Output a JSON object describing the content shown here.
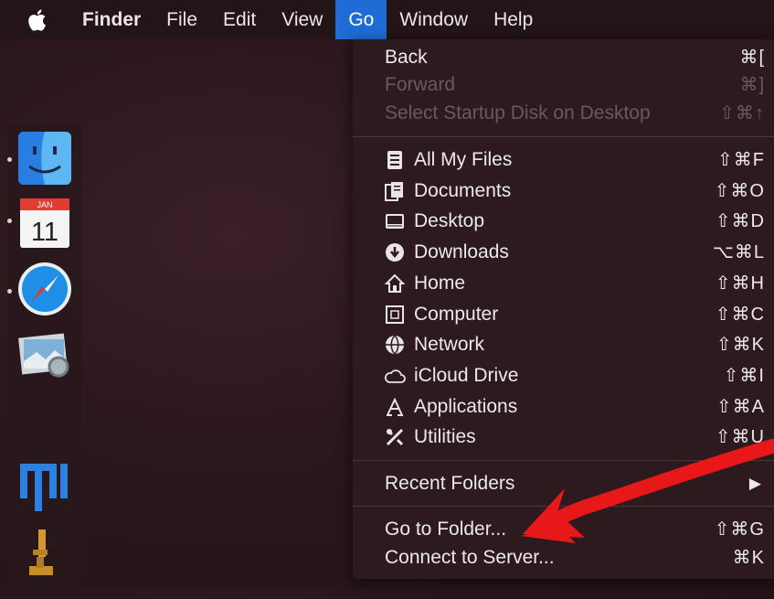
{
  "menubar": {
    "apple_icon": "apple-icon",
    "items": [
      "Finder",
      "File",
      "Edit",
      "View",
      "Go",
      "Window",
      "Help"
    ],
    "active": "Go"
  },
  "dock": {
    "items": [
      "finder-icon",
      "calendar-icon",
      "safari-icon",
      "preview-icon",
      "mi-icon",
      "microscope-icon"
    ],
    "calendar": {
      "month": "JAN",
      "day": "11"
    }
  },
  "go_menu": {
    "history": [
      {
        "label": "Back",
        "shortcut": "⌘[",
        "enabled": true
      },
      {
        "label": "Forward",
        "shortcut": "⌘]",
        "enabled": false
      },
      {
        "label": "Select Startup Disk on Desktop",
        "shortcut": "⇧⌘↑",
        "enabled": false
      }
    ],
    "places": [
      {
        "label": "All My Files",
        "shortcut": "⇧⌘F",
        "icon": "all-my-files-icon"
      },
      {
        "label": "Documents",
        "shortcut": "⇧⌘O",
        "icon": "documents-icon"
      },
      {
        "label": "Desktop",
        "shortcut": "⇧⌘D",
        "icon": "desktop-icon"
      },
      {
        "label": "Downloads",
        "shortcut": "⌥⌘L",
        "icon": "downloads-icon"
      },
      {
        "label": "Home",
        "shortcut": "⇧⌘H",
        "icon": "home-icon"
      },
      {
        "label": "Computer",
        "shortcut": "⇧⌘C",
        "icon": "computer-icon"
      },
      {
        "label": "Network",
        "shortcut": "⇧⌘K",
        "icon": "network-icon"
      },
      {
        "label": "iCloud Drive",
        "shortcut": "⇧⌘I",
        "icon": "icloud-icon"
      },
      {
        "label": "Applications",
        "shortcut": "⇧⌘A",
        "icon": "applications-icon"
      },
      {
        "label": "Utilities",
        "shortcut": "⇧⌘U",
        "icon": "utilities-icon"
      }
    ],
    "recent_folders": {
      "label": "Recent Folders",
      "submenu_indicator": "▶"
    },
    "actions": [
      {
        "label": "Go to Folder...",
        "shortcut": "⇧⌘G"
      },
      {
        "label": "Connect to Server...",
        "shortcut": "⌘K"
      }
    ]
  },
  "colors": {
    "menubar_bg": "#221417",
    "active_menu": "#1f6cd6",
    "menu_bg": "#2c1a1e",
    "annotation": "#e81818"
  }
}
